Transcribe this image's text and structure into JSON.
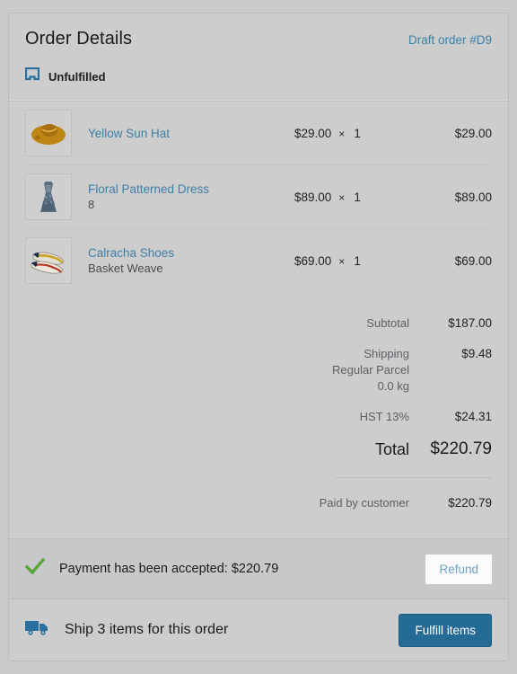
{
  "card": {
    "title": "Order Details",
    "draft_link": "Draft order #D9",
    "status": {
      "label": "Unfulfilled",
      "icon": "unfulfilled-box-icon",
      "color": "#2a6f9e"
    }
  },
  "line_items": [
    {
      "name": "Yellow Sun Hat",
      "variant": "",
      "unit_price": "$29.00",
      "times": "×",
      "quantity": "1",
      "total": "$29.00",
      "thumb": "yellow-sun-hat-thumbnail"
    },
    {
      "name": "Floral Patterned Dress",
      "variant": "8",
      "unit_price": "$89.00",
      "times": "×",
      "quantity": "1",
      "total": "$89.00",
      "thumb": "floral-patterned-dress-thumbnail"
    },
    {
      "name": "Calracha Shoes",
      "variant": "Basket Weave",
      "unit_price": "$69.00",
      "times": "×",
      "quantity": "1",
      "total": "$69.00",
      "thumb": "calracha-shoes-thumbnail"
    }
  ],
  "totals": {
    "subtotal_label": "Subtotal",
    "subtotal_value": "$187.00",
    "shipping_label": "Shipping",
    "shipping_method": "Regular Parcel",
    "shipping_weight": "0.0 kg",
    "shipping_value": "$9.48",
    "tax_label": "HST 13%",
    "tax_value": "$24.31",
    "total_label": "Total",
    "total_value": "$220.79",
    "paid_label": "Paid by customer",
    "paid_value": "$220.79"
  },
  "payment_bar": {
    "icon": "green-check-icon",
    "message": "Payment has been accepted: $220.79",
    "refund_label": "Refund",
    "check_color": "#59a639"
  },
  "footer": {
    "icon": "truck-icon",
    "message": "Ship 3 items for this order",
    "fulfill_label": "Fulfill items",
    "button_color": "#246b96"
  }
}
